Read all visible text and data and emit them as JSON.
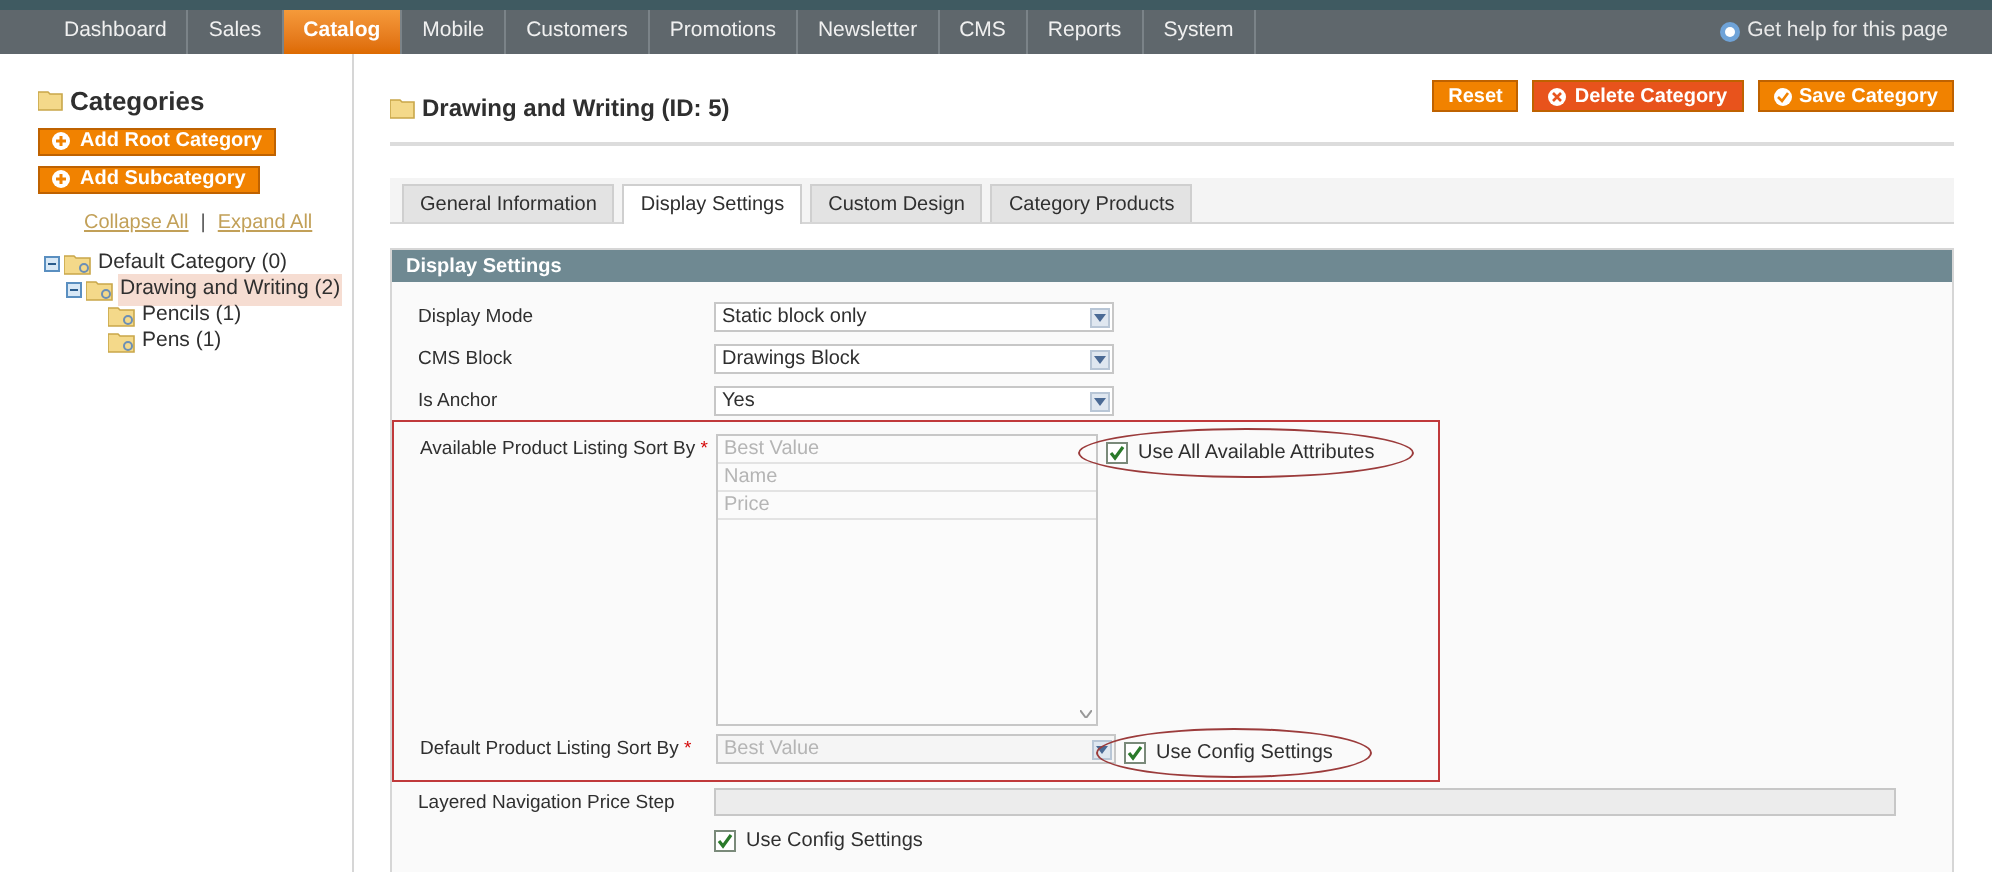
{
  "nav": {
    "items": [
      {
        "label": "Dashboard",
        "selected": false
      },
      {
        "label": "Sales",
        "selected": false
      },
      {
        "label": "Catalog",
        "selected": true
      },
      {
        "label": "Mobile",
        "selected": false
      },
      {
        "label": "Customers",
        "selected": false
      },
      {
        "label": "Promotions",
        "selected": false
      },
      {
        "label": "Newsletter",
        "selected": false
      },
      {
        "label": "CMS",
        "selected": false
      },
      {
        "label": "Reports",
        "selected": false
      },
      {
        "label": "System",
        "selected": false
      }
    ],
    "help": "Get help for this page"
  },
  "sidebar": {
    "title": "Categories",
    "buttons": [
      "Add Root Category",
      "Add Subcategory"
    ],
    "collapse_all": "Collapse All",
    "separator": "|",
    "expand_all": "Expand All",
    "tree": [
      {
        "label": "Default Category (0)",
        "expanded": true,
        "selected": false,
        "children": [
          {
            "label": "Drawing and Writing (2)",
            "expanded": true,
            "selected": true,
            "children": [
              {
                "label": "Pencils (1)",
                "selected": false
              },
              {
                "label": "Pens (1)",
                "selected": false
              }
            ]
          }
        ]
      }
    ]
  },
  "page": {
    "title": "Drawing and Writing (ID: 5)",
    "buttons": [
      {
        "label": "Reset",
        "kind": "plain"
      },
      {
        "label": "Delete Category",
        "kind": "delete"
      },
      {
        "label": "Save Category",
        "kind": "save"
      }
    ],
    "tabs": [
      {
        "label": "General Information",
        "selected": false
      },
      {
        "label": "Display Settings",
        "selected": true
      },
      {
        "label": "Custom Design",
        "selected": false
      },
      {
        "label": "Category Products",
        "selected": false
      }
    ]
  },
  "section": {
    "title": "Display Settings",
    "required_mark": "*",
    "fields": [
      {
        "label": "Display Mode",
        "kind": "select",
        "value": "Static block only",
        "required": false,
        "disabled": false,
        "framed": false
      },
      {
        "label": "CMS Block",
        "kind": "select",
        "value": "Drawings Block",
        "required": false,
        "disabled": false,
        "framed": false
      },
      {
        "label": "Is Anchor",
        "kind": "select",
        "value": "Yes",
        "required": false,
        "disabled": false,
        "framed": false
      },
      {
        "label": "Available Product Listing Sort By",
        "kind": "multiselect",
        "options": [
          "Best Value",
          "Name",
          "Price"
        ],
        "required": true,
        "disabled": true,
        "framed": true,
        "checkbox": {
          "label": "Use All Available Attributes",
          "checked": true,
          "circled": true
        }
      },
      {
        "label": "Default Product Listing Sort By",
        "kind": "select",
        "value": "Best Value",
        "required": true,
        "disabled": true,
        "framed": true,
        "checkbox": {
          "label": "Use Config Settings",
          "checked": true,
          "circled": true
        }
      },
      {
        "label": "Layered Navigation Price Step",
        "kind": "text",
        "required": false,
        "disabled": true,
        "framed": false,
        "checkbox": {
          "label": "Use Config Settings",
          "checked": true,
          "circled": false
        }
      }
    ]
  }
}
